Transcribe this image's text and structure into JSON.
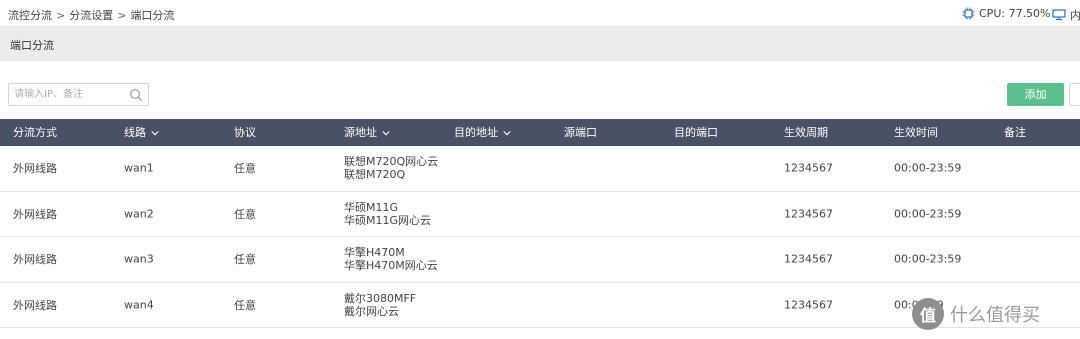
{
  "breadcrumb": {
    "items": [
      "流控分流",
      "分流设置",
      "端口分流"
    ],
    "separator": ">"
  },
  "status": {
    "cpu_label": "CPU: 77.50%",
    "mem_label": "内"
  },
  "section": {
    "title": "端口分流"
  },
  "search": {
    "placeholder": "请输入IP、备注",
    "value": ""
  },
  "toolbar": {
    "add_label": "添加"
  },
  "table": {
    "columns": [
      {
        "label": "分流方式",
        "sortable": false
      },
      {
        "label": "线路",
        "sortable": true
      },
      {
        "label": "协议",
        "sortable": false
      },
      {
        "label": "源地址",
        "sortable": true
      },
      {
        "label": "目的地址",
        "sortable": true
      },
      {
        "label": "源端口",
        "sortable": false
      },
      {
        "label": "目的端口",
        "sortable": false
      },
      {
        "label": "生效周期",
        "sortable": false
      },
      {
        "label": "生效时间",
        "sortable": false
      },
      {
        "label": "备注",
        "sortable": false
      }
    ],
    "rows": [
      {
        "mode": "外网线路",
        "line": "wan1",
        "protocol": "任意",
        "src1": "联想M720Q网心云",
        "src2": "联想M720Q",
        "dst": "",
        "sport": "",
        "dport": "",
        "period": "1234567",
        "time": "00:00-23:59",
        "note": ""
      },
      {
        "mode": "外网线路",
        "line": "wan2",
        "protocol": "任意",
        "src1": "华硕M11G",
        "src2": "华硕M11G网心云",
        "dst": "",
        "sport": "",
        "dport": "",
        "period": "1234567",
        "time": "00:00-23:59",
        "note": ""
      },
      {
        "mode": "外网线路",
        "line": "wan3",
        "protocol": "任意",
        "src1": "华擎H470M",
        "src2": "华擎H470M网心云",
        "dst": "",
        "sport": "",
        "dport": "",
        "period": "1234567",
        "time": "00:00-23:59",
        "note": ""
      },
      {
        "mode": "外网线路",
        "line": "wan4",
        "protocol": "任意",
        "src1": "戴尔3080MFF",
        "src2": "戴尔网心云",
        "dst": "",
        "sport": "",
        "dport": "",
        "period": "1234567",
        "time": "00:0 -  59",
        "note": ""
      }
    ]
  },
  "watermark": {
    "logo_text": "值",
    "text": "什么值得买"
  },
  "colors": {
    "header_bg": "#495264",
    "accent_green": "#5cc08c",
    "section_bg": "#ececec",
    "icon_blue": "#2e6fb5"
  },
  "icons": {
    "cpu": "cpu-chip-icon",
    "mem": "monitor-icon",
    "search": "search-icon",
    "sort": "chevron-down-icon"
  }
}
